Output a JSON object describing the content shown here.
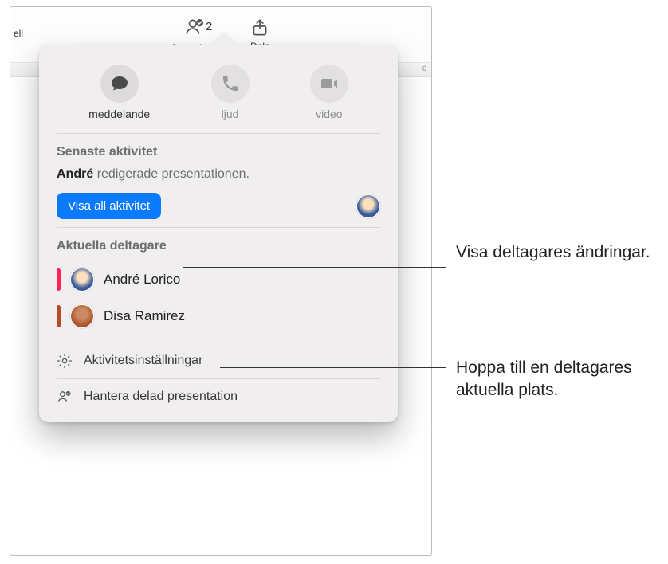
{
  "toolbar": {
    "left_stub": "ell",
    "items": [
      {
        "label": "Samarbete",
        "count": "2"
      },
      {
        "label": "Dela"
      }
    ],
    "ruler_mark": "0"
  },
  "popover": {
    "comm": {
      "message": "meddelande",
      "audio": "ljud",
      "video": "video"
    },
    "recent": {
      "title": "Senaste aktivitet",
      "actor": "André",
      "action": "redigerade presentationen.",
      "show_all": "Visa all aktivitet"
    },
    "participants": {
      "title": "Aktuella deltagare",
      "list": [
        {
          "name": "André Lorico"
        },
        {
          "name": "Disa Ramirez"
        }
      ]
    },
    "footer": {
      "activity_settings": "Aktivitetsinställningar",
      "manage_shared": "Hantera delad presentation"
    }
  },
  "callouts": {
    "c1": "Visa deltagares ändringar.",
    "c2": "Hoppa till en deltagares aktuella plats."
  }
}
